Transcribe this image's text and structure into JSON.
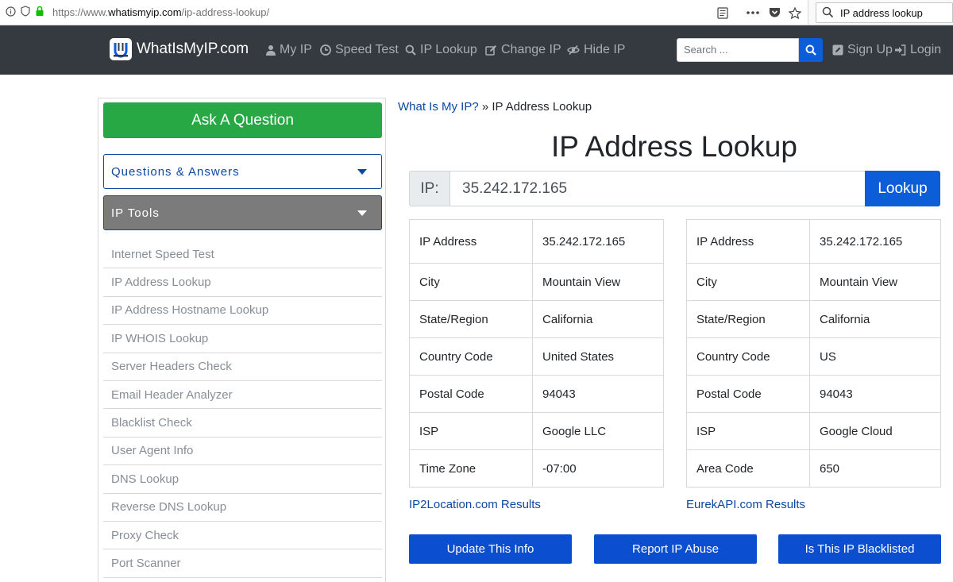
{
  "browser": {
    "url_prefix": "https://www.",
    "url_domain": "whatismyip.com",
    "url_path": "/ip-address-lookup/",
    "search_value": "IP address lookup"
  },
  "nav": {
    "logo_text": "WhatIsMyIP.com",
    "items": [
      {
        "label": "My IP",
        "icon": "user-icon"
      },
      {
        "label": "Speed Test",
        "icon": "clock-icon"
      },
      {
        "label": "IP Lookup",
        "icon": "search-icon"
      },
      {
        "label": "Change IP",
        "icon": "edit-icon"
      },
      {
        "label": "Hide IP",
        "icon": "eye-slash-icon"
      }
    ],
    "search_placeholder": "Search ...",
    "signup_label": "Sign Up",
    "login_label": "Login"
  },
  "sidebar": {
    "ask_label": "Ask A Question",
    "qa_label": "Questions & Answers",
    "tools_label": "IP Tools",
    "tools": [
      "Internet Speed Test",
      "IP Address Lookup",
      "IP Address Hostname Lookup",
      "IP WHOIS Lookup",
      "Server Headers Check",
      "Email Header Analyzer",
      "Blacklist Check",
      "User Agent Info",
      "DNS Lookup",
      "Reverse DNS Lookup",
      "Proxy Check",
      "Port Scanner"
    ]
  },
  "main": {
    "breadcrumb_link": "What Is My IP?",
    "breadcrumb_sep": " » ",
    "breadcrumb_current": "IP Address Lookup",
    "title": "IP Address Lookup",
    "ip_prefix": "IP:",
    "ip_value": "35.242.172.165",
    "lookup_label": "Lookup",
    "table_left": [
      [
        "IP Address",
        "35.242.172.165"
      ],
      [
        "City",
        "Mountain View"
      ],
      [
        "State/Region",
        "California"
      ],
      [
        "Country Code",
        "United States"
      ],
      [
        "Postal Code",
        "94043"
      ],
      [
        "ISP",
        "Google LLC"
      ],
      [
        "Time Zone",
        "-07:00"
      ]
    ],
    "table_right": [
      [
        "IP Address",
        "35.242.172.165"
      ],
      [
        "City",
        "Mountain View"
      ],
      [
        "State/Region",
        "California"
      ],
      [
        "Country Code",
        "US"
      ],
      [
        "Postal Code",
        "94043"
      ],
      [
        "ISP",
        "Google Cloud"
      ],
      [
        "Area Code",
        "650"
      ]
    ],
    "link_left": "IP2Location.com Results",
    "link_right": "EurekAPI.com Results",
    "buttons": [
      "Update This Info",
      "Report IP Abuse",
      "Is This IP Blacklisted"
    ]
  },
  "colors": {
    "nav_bg": "#343a40",
    "primary": "#0b5ed7",
    "success": "#28a745",
    "link": "#0d47a1"
  }
}
